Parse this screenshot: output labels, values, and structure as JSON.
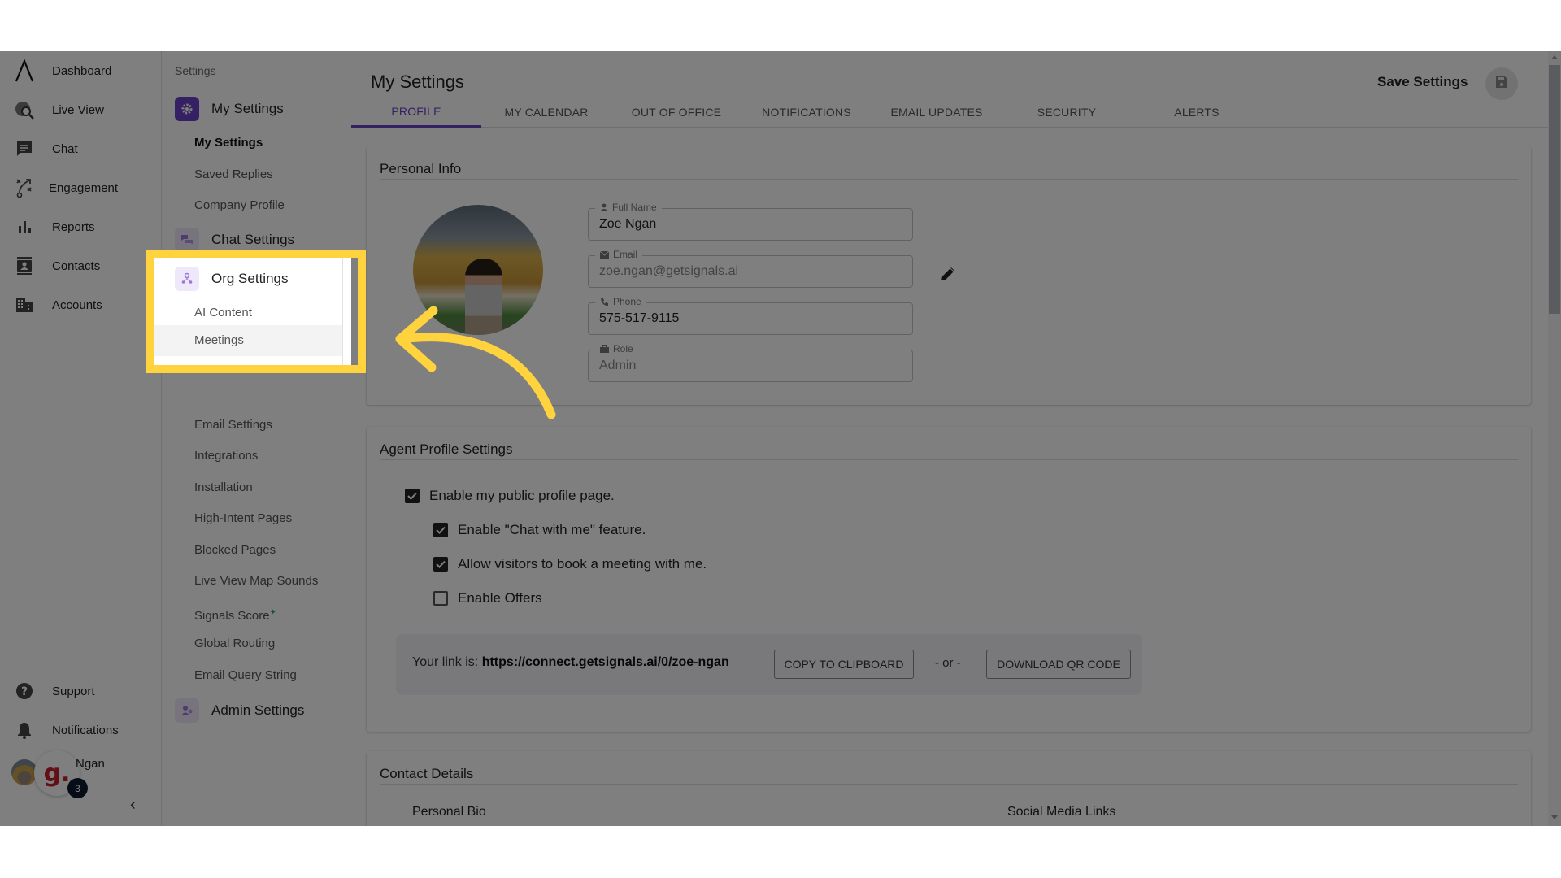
{
  "nav": {
    "items": [
      {
        "label": "Dashboard",
        "icon": "logo-icon"
      },
      {
        "label": "Live View",
        "icon": "globe-search-icon"
      },
      {
        "label": "Chat",
        "icon": "chat-icon"
      },
      {
        "label": "Engagement",
        "icon": "strategy-icon"
      },
      {
        "label": "Reports",
        "icon": "bar-chart-icon"
      },
      {
        "label": "Contacts",
        "icon": "contact-card-icon"
      },
      {
        "label": "Accounts",
        "icon": "building-icon"
      }
    ],
    "bottom": [
      {
        "label": "Support",
        "icon": "help-icon"
      },
      {
        "label": "Notifications",
        "icon": "bell-icon"
      }
    ],
    "user": {
      "name": "Ngan",
      "bubble_letter": "g.",
      "badge_count": "3"
    },
    "collapse_glyph": "‹"
  },
  "settings_nav": {
    "title": "Settings",
    "sections": [
      {
        "label": "My Settings",
        "icon": "gear-icon",
        "active": true,
        "items": [
          {
            "label": "My Settings",
            "active": true
          },
          {
            "label": "Saved Replies"
          },
          {
            "label": "Company Profile"
          }
        ]
      },
      {
        "label": "Chat Settings",
        "icon": "chat-bubbles-icon"
      },
      {
        "label": "Org Settings",
        "icon": "org-icon",
        "items": [
          {
            "label": "AI Content"
          },
          {
            "label": "Meetings",
            "hovered": true
          },
          {
            "label": "Email Settings"
          },
          {
            "label": "Integrations"
          },
          {
            "label": "Installation"
          },
          {
            "label": "High-Intent Pages"
          },
          {
            "label": "Blocked Pages"
          },
          {
            "label": "Live View Map Sounds"
          },
          {
            "label": "Signals Score",
            "badge": "✦"
          },
          {
            "label": "Global Routing"
          },
          {
            "label": "Email Query String"
          }
        ]
      },
      {
        "label": "Admin Settings",
        "icon": "admin-icon"
      }
    ]
  },
  "main": {
    "title": "My Settings",
    "save_label": "Save Settings",
    "tabs": [
      {
        "label": "PROFILE",
        "active": true
      },
      {
        "label": "MY CALENDAR"
      },
      {
        "label": "OUT OF OFFICE"
      },
      {
        "label": "NOTIFICATIONS"
      },
      {
        "label": "EMAIL UPDATES"
      },
      {
        "label": "SECURITY"
      },
      {
        "label": "ALERTS"
      }
    ],
    "personal_info": {
      "title": "Personal Info",
      "fields": [
        {
          "label": "Full Name",
          "value": "Zoe Ngan",
          "icon": "person-icon",
          "disabled": false
        },
        {
          "label": "Email",
          "value": "zoe.ngan@getsignals.ai",
          "icon": "mail-icon",
          "disabled": true
        },
        {
          "label": "Phone",
          "value": "575-517-9115",
          "icon": "phone-icon",
          "disabled": false
        },
        {
          "label": "Role",
          "value": "Admin",
          "icon": "briefcase-icon",
          "disabled": true
        }
      ]
    },
    "agent_profile": {
      "title": "Agent Profile Settings",
      "checkboxes": [
        {
          "label": "Enable my public profile page.",
          "checked": true
        },
        {
          "label": "Enable \"Chat with me\" feature.",
          "checked": true
        },
        {
          "label": "Allow visitors to book a meeting with me.",
          "checked": true
        },
        {
          "label": "Enable Offers",
          "checked": false
        }
      ],
      "link_prefix": "Your link is:",
      "link_url": "https://connect.getsignals.ai/0/zoe-ngan",
      "copy_label": "COPY TO CLIPBOARD",
      "or_label": "- or -",
      "qr_label": "DOWNLOAD QR CODE"
    },
    "contact_details": {
      "title": "Contact Details",
      "bio_label": "Personal Bio",
      "social_label": "Social Media Links"
    }
  },
  "colors": {
    "accent": "#6a41c6",
    "highlight": "#ffd33d",
    "overlay": "rgba(0,0,0,0.5)"
  }
}
